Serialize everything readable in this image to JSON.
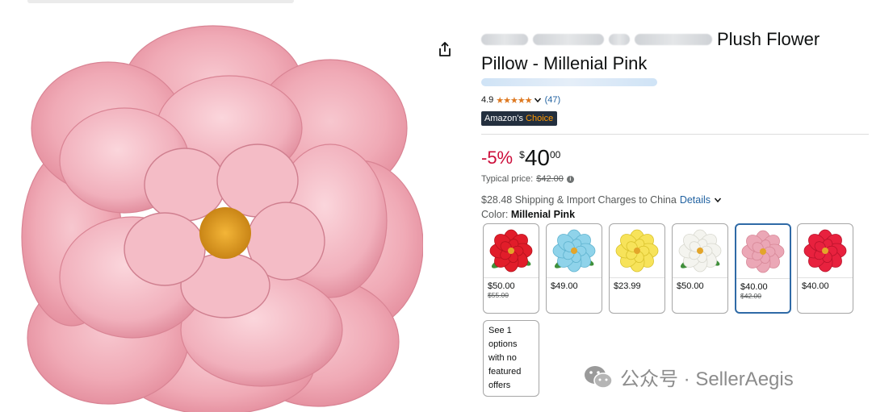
{
  "product": {
    "title_line1_visible": "Plush Flower",
    "title_line2": "Pillow - Millenial Pink"
  },
  "rating": {
    "score": "4.9",
    "stars": "★★★★★",
    "count": "(47)"
  },
  "badge": {
    "prefix": "Amazon's",
    "suffix": "Choice"
  },
  "price": {
    "discount": "-5%",
    "symbol": "$",
    "whole": "40",
    "fraction": "00",
    "typical_label": "Typical price:",
    "typical_value": "$42.00"
  },
  "shipping": {
    "text": "$28.48 Shipping & Import Charges to China",
    "details_label": "Details"
  },
  "color": {
    "label": "Color:",
    "value": "Millenial Pink"
  },
  "swatches": [
    {
      "name": "red",
      "price": "$50.00",
      "original": "$55.00",
      "petal": "#e11d2a",
      "petal_dark": "#b5121c",
      "leaf": true,
      "selected": false
    },
    {
      "name": "blue",
      "price": "$49.00",
      "original": "",
      "petal": "#8fd3ea",
      "petal_dark": "#5fb3cf",
      "leaf": true,
      "selected": false
    },
    {
      "name": "yellow",
      "price": "$23.99",
      "original": "",
      "petal": "#f7e35a",
      "petal_dark": "#d9c22c",
      "leaf": false,
      "selected": false
    },
    {
      "name": "white",
      "price": "$50.00",
      "original": "",
      "petal": "#f4f4ef",
      "petal_dark": "#d8d8cf",
      "leaf": true,
      "selected": false
    },
    {
      "name": "pink",
      "price": "$40.00",
      "original": "$42.00",
      "petal": "#eba7b6",
      "petal_dark": "#d78797",
      "leaf": false,
      "selected": true
    },
    {
      "name": "crimson",
      "price": "$40.00",
      "original": "",
      "petal": "#e8213e",
      "petal_dark": "#b8132b",
      "leaf": false,
      "selected": false
    }
  ],
  "see_options": {
    "text": "See 1 options with no featured offers"
  },
  "watermark": {
    "text": "公众号 · SellerAegis"
  },
  "colors": {
    "link": "#2162a1",
    "discount": "#cc0c39",
    "star": "#de7921",
    "badge_bg": "#232f3e",
    "selected_border": "#2f6aa6"
  }
}
